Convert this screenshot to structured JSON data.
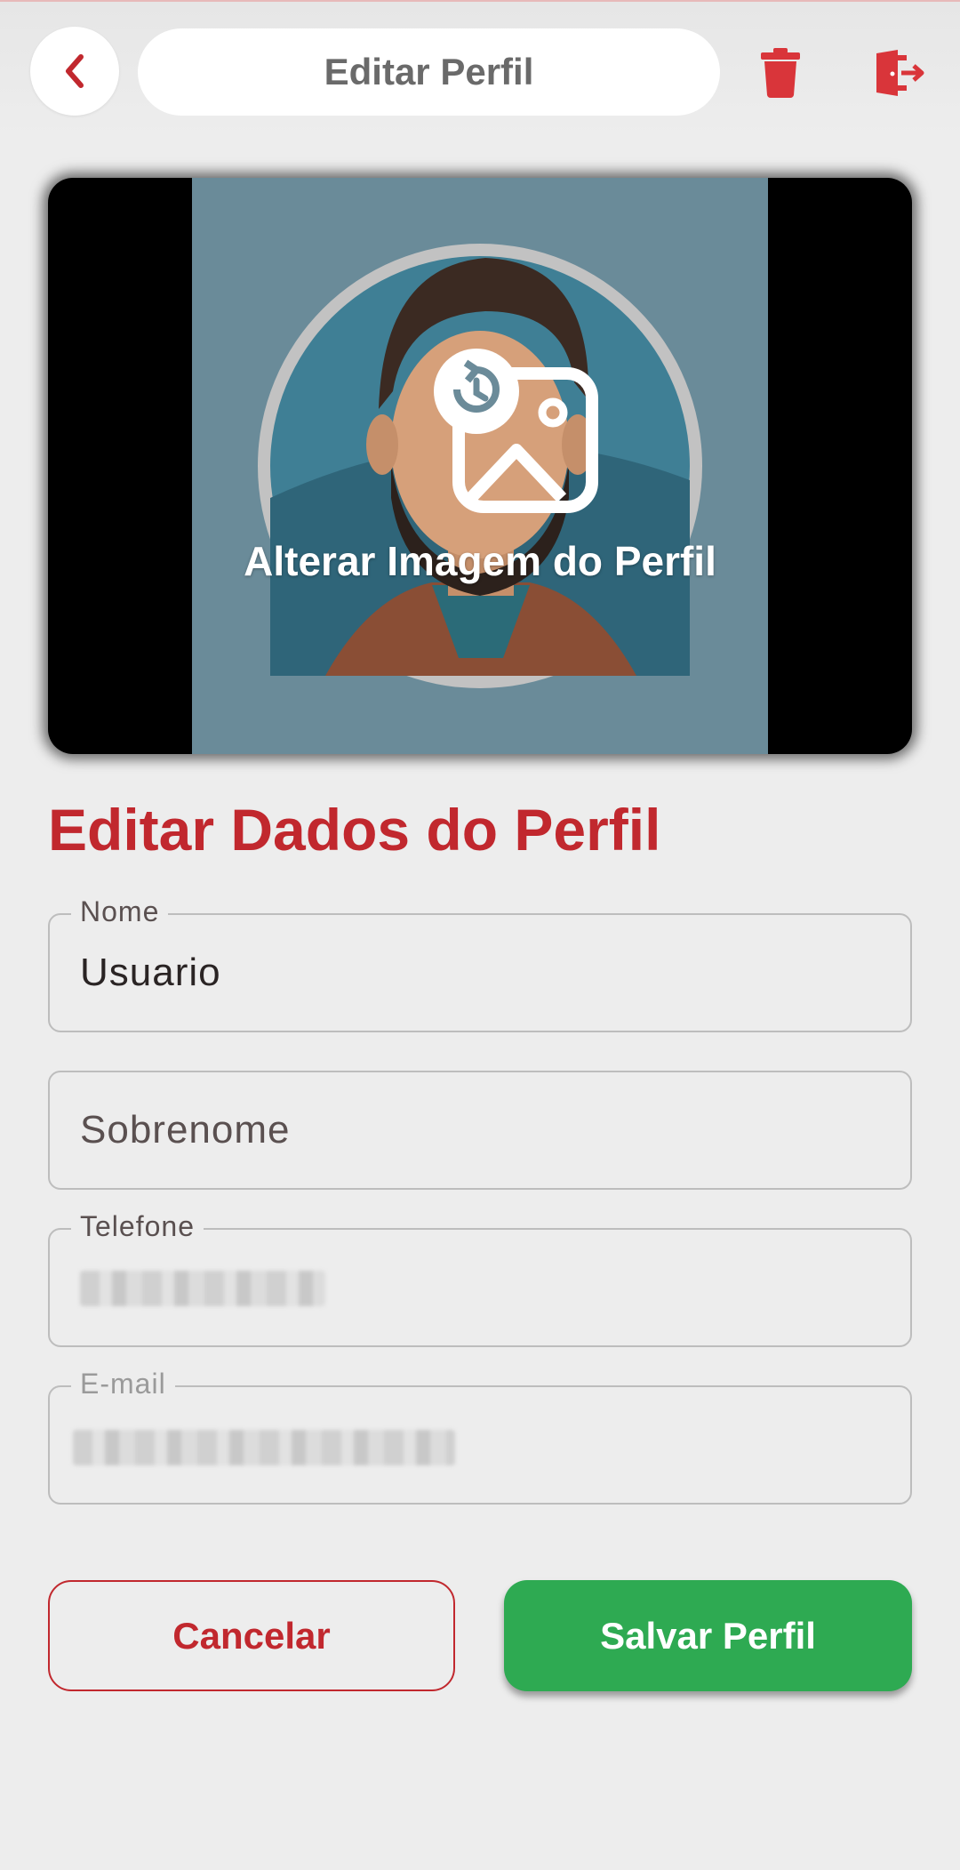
{
  "header": {
    "title": "Editar Perfil",
    "back_icon": "chevron-left-icon",
    "delete_icon": "trash-icon",
    "logout_icon": "exit-door-icon"
  },
  "profile_image": {
    "change_label": "Alterar Imagem do Perfil",
    "edit_icon": "change-image-icon"
  },
  "form": {
    "title": "Editar Dados do Perfil",
    "nome": {
      "label": "Nome",
      "value": "Usuario"
    },
    "sobrenome": {
      "placeholder": "Sobrenome"
    },
    "telefone": {
      "label": "Telefone"
    },
    "email": {
      "label": "E-mail"
    }
  },
  "actions": {
    "cancel_label": "Cancelar",
    "save_label": "Salvar Perfil"
  },
  "colors": {
    "accent_red": "#c1282e",
    "save_green": "#2eaa52",
    "background": "#ededed"
  }
}
